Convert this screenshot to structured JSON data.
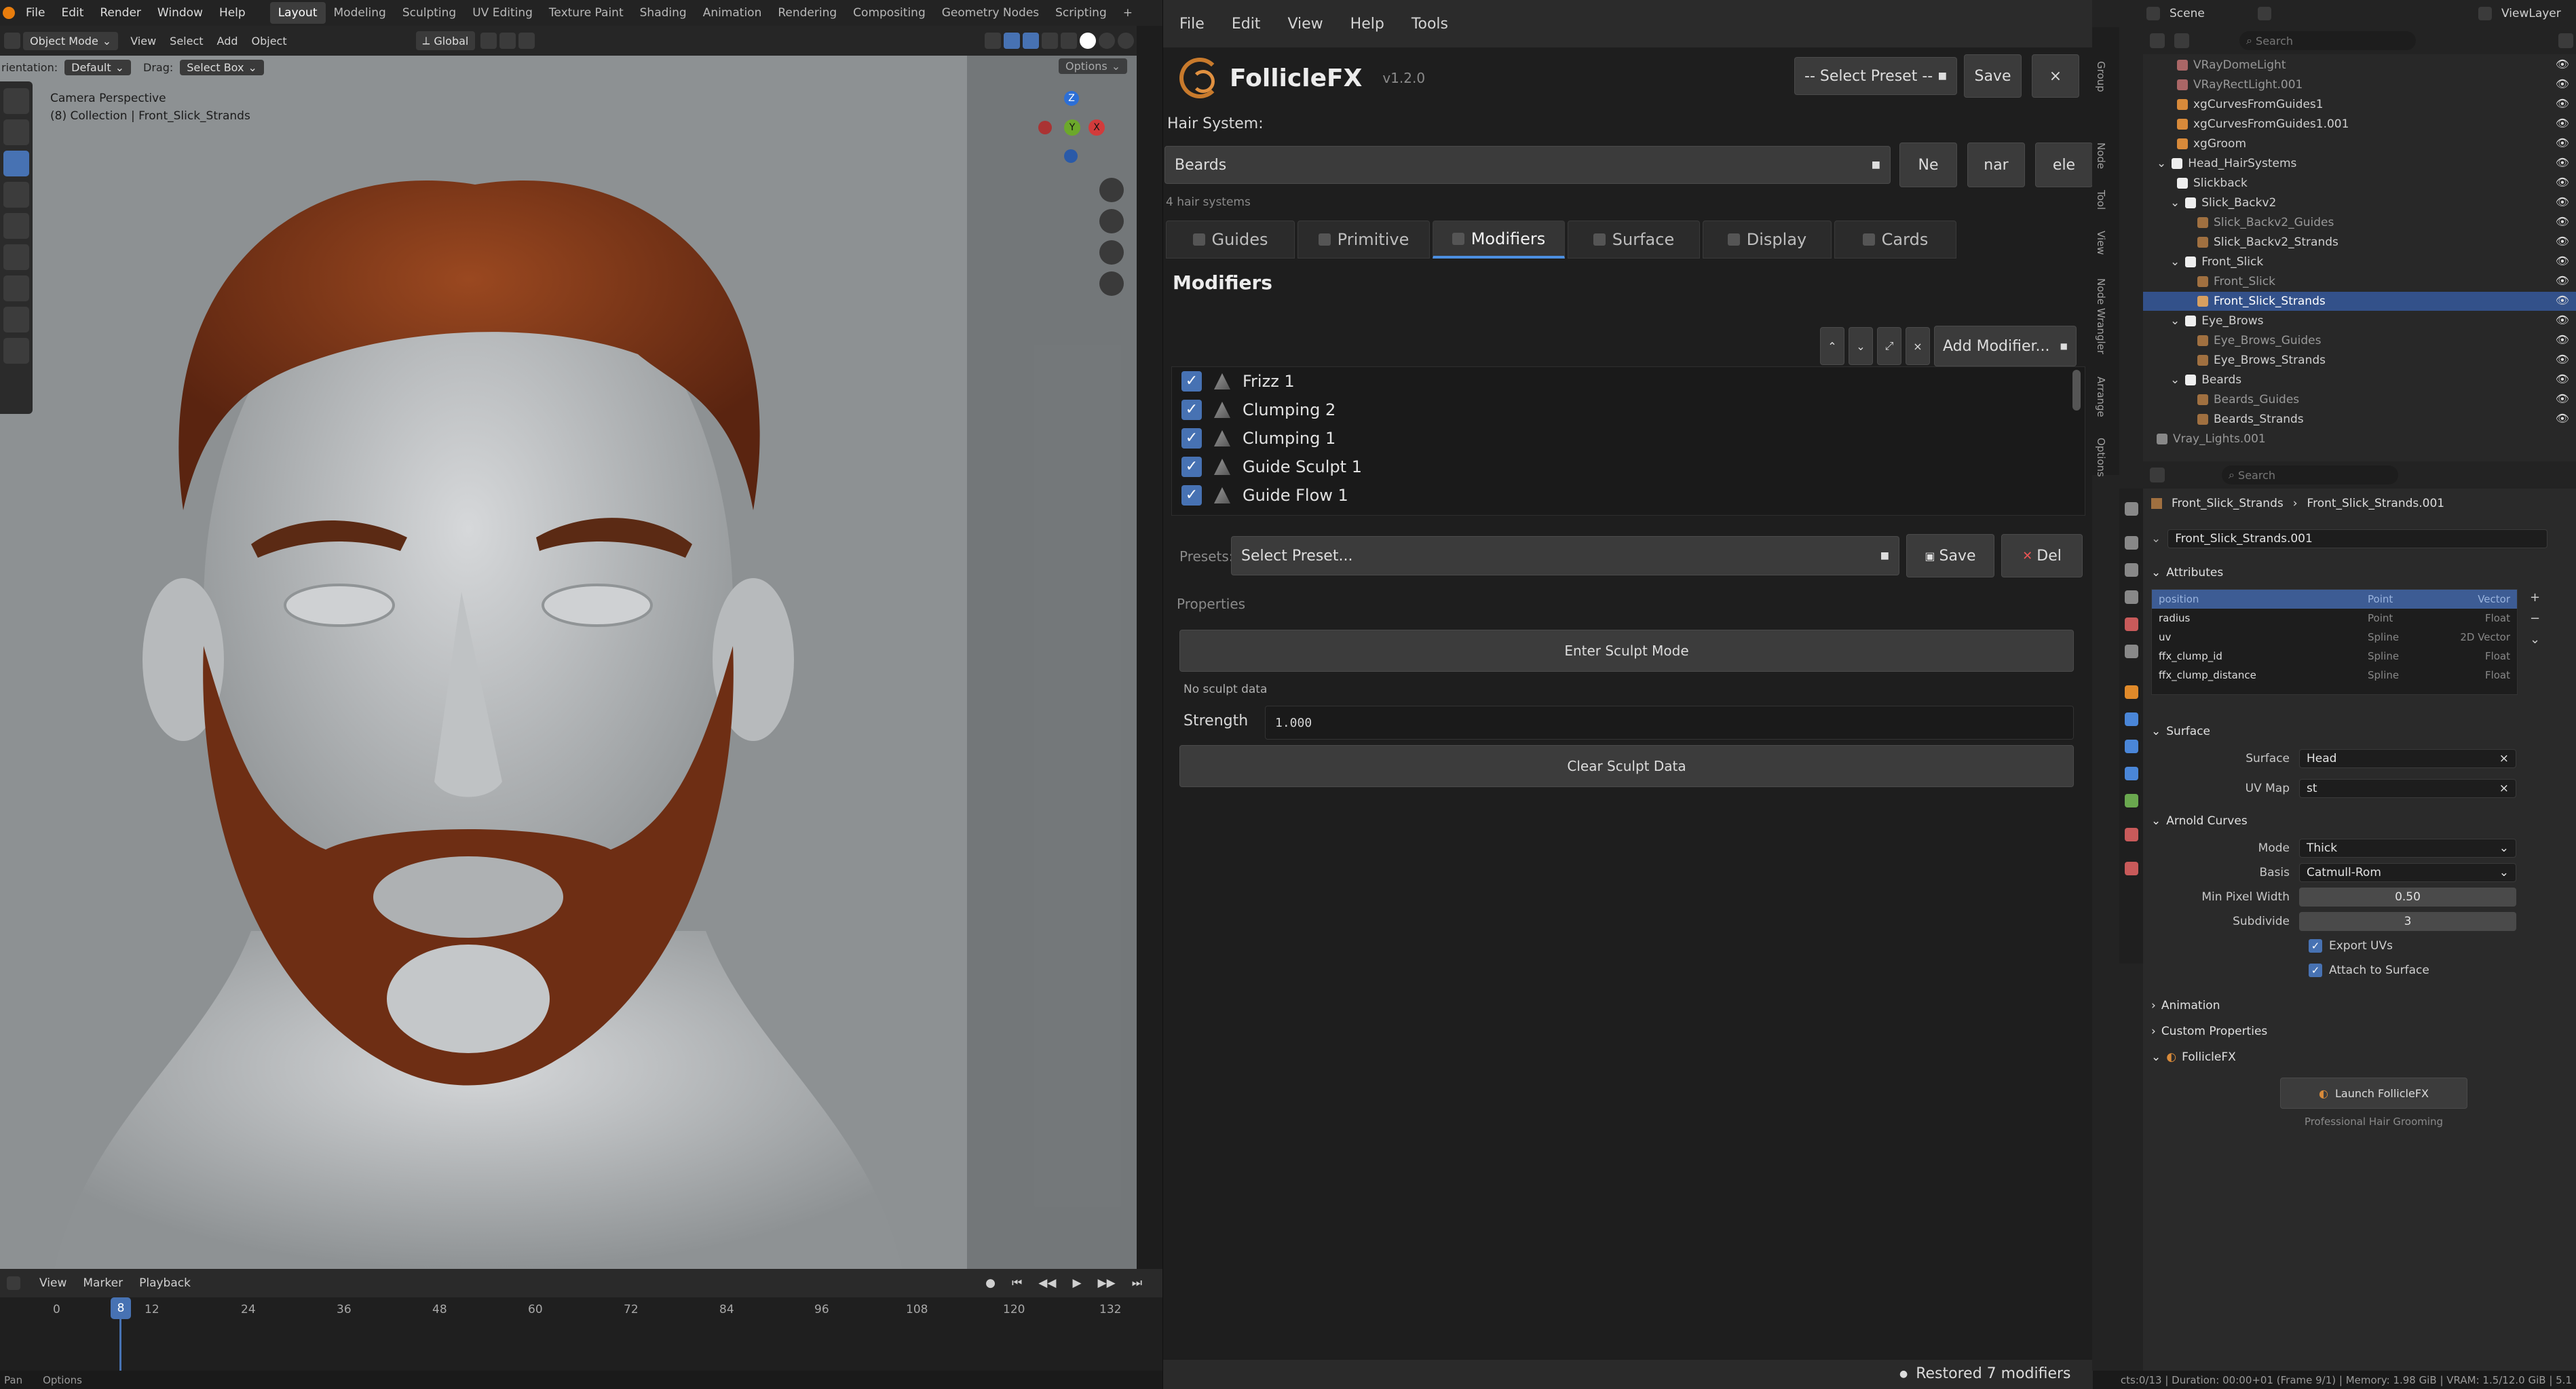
{
  "blender": {
    "menu": [
      "File",
      "Edit",
      "Render",
      "Window",
      "Help"
    ],
    "workspaces": [
      "Layout",
      "Modeling",
      "Sculpting",
      "UV Editing",
      "Texture Paint",
      "Shading",
      "Animation",
      "Rendering",
      "Compositing",
      "Geometry Nodes",
      "Scripting"
    ],
    "active_workspace": "Layout",
    "header": {
      "mode": "Object Mode",
      "view": "View",
      "select": "Select",
      "add": "Add",
      "object": "Object",
      "transform": "Global",
      "options": "Options"
    },
    "tool_header": {
      "orientation_label": "rientation:",
      "orientation_value": "Default",
      "drag_label": "Drag:",
      "drag_value": "Select Box"
    },
    "viewport": {
      "camera_label": "Camera Perspective",
      "collection_label": "(8) Collection | Front_Slick_Strands",
      "gizmo_axes": [
        "Z",
        "Y",
        "X"
      ]
    },
    "timeline": {
      "view": "View",
      "marker": "Marker",
      "playback": "Playback",
      "current_frame": "8",
      "ticks": [
        "0",
        "12",
        "24",
        "36",
        "48",
        "60",
        "72",
        "84",
        "96",
        "108",
        "120",
        "132"
      ]
    },
    "status": {
      "left1": "Pan",
      "left2": "Options",
      "right": "cts:0/13 | Duration: 00:00+01 (Frame 9/1) | Memory: 1.98 GiB | VRAM: 1.5/12.0 GiB | 5.1"
    }
  },
  "ffx": {
    "menu": [
      "File",
      "Edit",
      "View",
      "Help",
      "Tools"
    ],
    "name": "FollicleFX",
    "version": "v1.2.0",
    "preset_select": "-- Select Preset --",
    "save_btn": "Save",
    "close_btn": "×",
    "hair_system_label": "Hair System:",
    "hair_system_value": "Beards",
    "new_btn": "Ne",
    "rename_btn": "nar",
    "delete_btn": "ele",
    "hair_count": "4 hair systems",
    "tabs": [
      "Guides",
      "Primitive",
      "Modifiers",
      "Surface",
      "Display",
      "Cards"
    ],
    "active_tab": "Modifiers",
    "modifiers_heading": "Modifiers",
    "add_modifier": "Add Modifier...",
    "modifiers": [
      {
        "label": "Frizz 1",
        "checked": "✓"
      },
      {
        "label": "Clumping 2",
        "checked": "✓"
      },
      {
        "label": "Clumping 1",
        "checked": "✓"
      },
      {
        "label": "Guide Sculpt 1",
        "checked": "✓"
      },
      {
        "label": "Guide Flow 1",
        "checked": "✓"
      }
    ],
    "presets_label": "Presets:",
    "presets_value": "Select Preset...",
    "presets_save": "Save",
    "presets_del": "Del",
    "properties_label": "Properties",
    "sculpt_btn": "Enter Sculpt Mode",
    "no_sculpt": "No sculpt data",
    "strength_label": "Strength",
    "strength_value": "1.000",
    "clear_sculpt": "Clear Sculpt Data",
    "status": "Restored 7 modifiers"
  },
  "outliner": {
    "scene": "Scene",
    "viewlayer": "ViewLayer",
    "search_placeholder": "Search",
    "rows": [
      {
        "label": "VRayDomeLight",
        "indent": 1
      },
      {
        "label": "VRayRectLight.001",
        "indent": 1
      },
      {
        "label": "xgCurvesFromGuides1",
        "indent": 1
      },
      {
        "label": "xgCurvesFromGuides1.001",
        "indent": 1
      },
      {
        "label": "xgGroom",
        "indent": 1
      },
      {
        "label": "Head_HairSystems",
        "indent": 0
      },
      {
        "label": "Slickback",
        "indent": 1
      },
      {
        "label": "Slick_Backv2",
        "indent": 1
      },
      {
        "label": "Slick_Backv2_Guides",
        "indent": 2
      },
      {
        "label": "Slick_Backv2_Strands",
        "indent": 2
      },
      {
        "label": "Front_Slick",
        "indent": 1
      },
      {
        "label": "Front_Slick",
        "indent": 2
      },
      {
        "label": "Front_Slick_Strands",
        "indent": 2
      },
      {
        "label": "Eye_Brows",
        "indent": 1
      },
      {
        "label": "Eye_Brows_Guides",
        "indent": 2
      },
      {
        "label": "Eye_Brows_Strands",
        "indent": 2
      },
      {
        "label": "Beards",
        "indent": 1
      },
      {
        "label": "Beards_Guides",
        "indent": 2
      },
      {
        "label": "Beards_Strands",
        "indent": 2
      },
      {
        "label": "Vray_Lights.001",
        "indent": 0
      }
    ],
    "selected": "Front_Slick_Strands"
  },
  "sidebar_tabs": [
    "Group",
    "Node",
    "Tool",
    "View",
    "Node Wrangler",
    "Arrange",
    "Options"
  ],
  "properties": {
    "breadcrumb1": "Front_Slick_Strands",
    "breadcrumb2": "Front_Slick_Strands.001",
    "datablock": "Front_Slick_Strands.001",
    "search_placeholder": "Search",
    "attributes_header": "Attributes",
    "attributes": [
      {
        "name": "position",
        "domain": "Point",
        "type": "Vector"
      },
      {
        "name": "radius",
        "domain": "Point",
        "type": "Float"
      },
      {
        "name": "uv",
        "domain": "Spline",
        "type": "2D Vector"
      },
      {
        "name": "ffx_clump_id",
        "domain": "Spline",
        "type": "Float"
      },
      {
        "name": "ffx_clump_distance",
        "domain": "Spline",
        "type": "Float"
      }
    ],
    "surface_header": "Surface",
    "surface_label": "Surface",
    "surface_value": "Head",
    "uvmap_label": "UV Map",
    "uvmap_value": "st",
    "arnold_header": "Arnold Curves",
    "mode_label": "Mode",
    "mode_value": "Thick",
    "basis_label": "Basis",
    "basis_value": "Catmull-Rom",
    "minpix_label": "Min Pixel Width",
    "minpix_value": "0.50",
    "subdiv_label": "Subdivide",
    "subdiv_value": "3",
    "export_uvs": "Export UVs",
    "attach_surface": "Attach to Surface",
    "animation_header": "Animation",
    "custom_header": "Custom Properties",
    "ffx_header": "FollicleFX",
    "launch_btn": "Launch FollicleFX",
    "tagline": "Professional Hair Grooming"
  },
  "colors": {
    "accent": "#4772b3",
    "hair": "#7a3416",
    "skin": "#c8cacc",
    "viewport_bg": "#8d9193"
  }
}
